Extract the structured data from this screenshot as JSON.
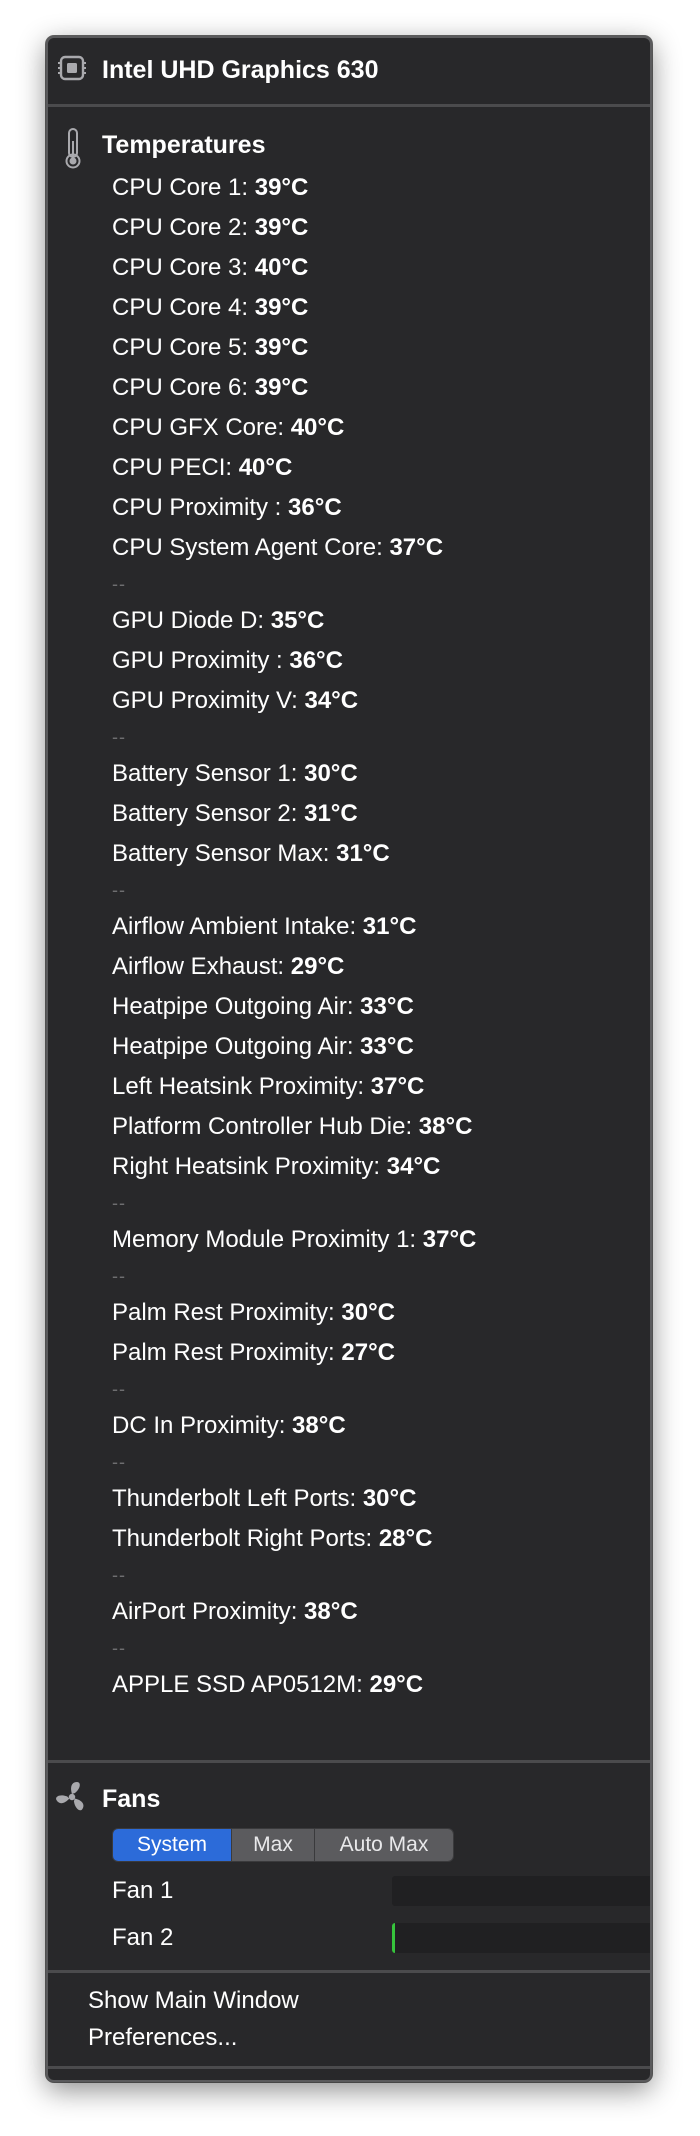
{
  "gpu": {
    "title": "Intel UHD Graphics 630",
    "icon": "chip-icon"
  },
  "temperatures": {
    "heading": "Temperatures",
    "icon": "thermometer-icon",
    "separator": "--",
    "groups": [
      [
        {
          "label": "CPU Core 1:",
          "value": "39°C"
        },
        {
          "label": "CPU Core 2:",
          "value": "39°C"
        },
        {
          "label": "CPU Core 3:",
          "value": "40°C"
        },
        {
          "label": "CPU Core 4:",
          "value": "39°C"
        },
        {
          "label": "CPU Core 5:",
          "value": "39°C"
        },
        {
          "label": "CPU Core 6:",
          "value": "39°C"
        },
        {
          "label": "CPU GFX Core:",
          "value": "40°C"
        },
        {
          "label": "CPU PECI:",
          "value": "40°C"
        },
        {
          "label": "CPU Proximity :",
          "value": "36°C"
        },
        {
          "label": "CPU System Agent Core:",
          "value": "37°C"
        }
      ],
      [
        {
          "label": "GPU Diode D:",
          "value": "35°C"
        },
        {
          "label": "GPU Proximity :",
          "value": "36°C"
        },
        {
          "label": "GPU Proximity V:",
          "value": "34°C"
        }
      ],
      [
        {
          "label": "Battery Sensor 1:",
          "value": "30°C"
        },
        {
          "label": "Battery Sensor 2:",
          "value": "31°C"
        },
        {
          "label": "Battery Sensor Max:",
          "value": "31°C"
        }
      ],
      [
        {
          "label": "Airflow Ambient Intake:",
          "value": "31°C"
        },
        {
          "label": "Airflow Exhaust:",
          "value": "29°C"
        },
        {
          "label": "Heatpipe Outgoing Air:",
          "value": "33°C"
        },
        {
          "label": "Heatpipe Outgoing Air:",
          "value": "33°C"
        },
        {
          "label": "Left Heatsink Proximity:",
          "value": "37°C"
        },
        {
          "label": "Platform Controller Hub Die:",
          "value": "38°C"
        },
        {
          "label": "Right Heatsink Proximity:",
          "value": "34°C"
        }
      ],
      [
        {
          "label": "Memory Module Proximity 1:",
          "value": "37°C"
        }
      ],
      [
        {
          "label": "Palm Rest Proximity:",
          "value": "30°C"
        },
        {
          "label": "Palm Rest Proximity:",
          "value": "27°C"
        }
      ],
      [
        {
          "label": "DC In Proximity:",
          "value": "38°C"
        }
      ],
      [
        {
          "label": "Thunderbolt Left Ports:",
          "value": "30°C"
        },
        {
          "label": "Thunderbolt Right Ports:",
          "value": "28°C"
        }
      ],
      [
        {
          "label": "AirPort Proximity:",
          "value": "38°C"
        }
      ],
      [
        {
          "label": "APPLE SSD AP0512M:",
          "value": "29°C"
        }
      ]
    ]
  },
  "fans": {
    "heading": "Fans",
    "icon": "fan-icon",
    "modes": [
      "System",
      "Max",
      "Auto Max"
    ],
    "selected_mode": "System",
    "items": [
      {
        "label": "Fan 1",
        "level": 0
      },
      {
        "label": "Fan 2",
        "level": 0.01
      }
    ],
    "bar_fill_color": "#36c43c"
  },
  "actions": {
    "show_main_window": "Show Main Window",
    "preferences": "Preferences..."
  },
  "footer": {
    "icon": "scroll-down-arrow-icon",
    "glyph": "▼"
  },
  "colors": {
    "menu_background": "#28282a",
    "separator": "#4b4b4d",
    "selected_segment": "#2c6bd9",
    "segment": "#5b5b5e"
  }
}
